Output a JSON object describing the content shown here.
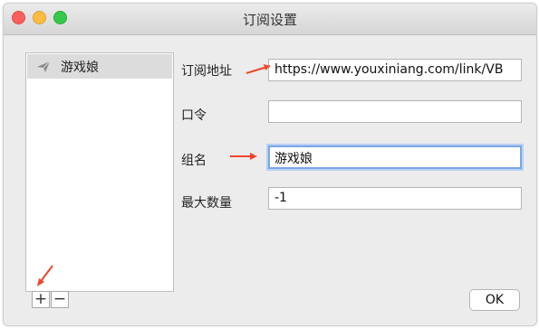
{
  "window": {
    "title": "订阅设置"
  },
  "subscriptions": {
    "items": [
      {
        "label": "游戏娘",
        "icon": "paper-plane-icon"
      }
    ],
    "add_label": "+",
    "remove_label": "−"
  },
  "form": {
    "url_label": "订阅地址",
    "url_value": "https://www.youxiniang.com/link/VB",
    "password_label": "口令",
    "password_value": "",
    "group_label": "组名",
    "group_value": "游戏娘",
    "max_label": "最大数量",
    "max_value": "-1"
  },
  "ok_label": "OK",
  "annotation_color": "#f0452a"
}
